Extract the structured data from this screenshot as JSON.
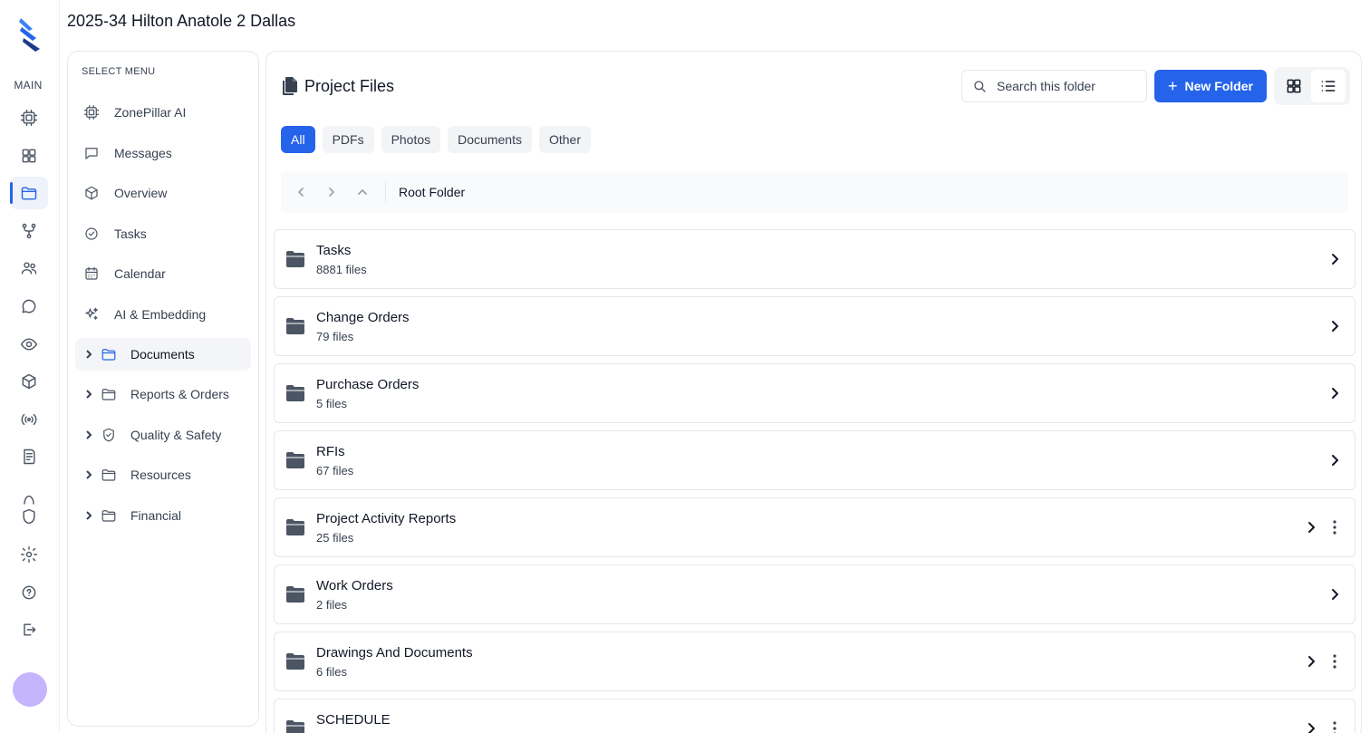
{
  "app": {
    "project_title": "2025-34 Hilton Anatole 2 Dallas"
  },
  "rail": {
    "section_label": "MAIN",
    "items": [
      {
        "icon": "chip-icon"
      },
      {
        "icon": "dashboard-icon"
      },
      {
        "icon": "folder-icon",
        "active": true
      },
      {
        "icon": "git-branch-icon"
      },
      {
        "icon": "users-icon"
      },
      {
        "icon": "chat-icon"
      },
      {
        "icon": "eye-icon"
      },
      {
        "icon": "cube-icon"
      },
      {
        "icon": "broadcast-icon"
      },
      {
        "icon": "receipt-icon"
      },
      {
        "icon": "shield-icon"
      },
      {
        "icon": "gear-icon"
      },
      {
        "icon": "help-icon"
      },
      {
        "icon": "logout-icon"
      }
    ]
  },
  "menu": {
    "heading": "SELECT MENU",
    "items": [
      {
        "label": "ZonePillar AI",
        "icon": "chip-icon"
      },
      {
        "label": "Messages",
        "icon": "message-icon"
      },
      {
        "label": "Overview",
        "icon": "cube-icon"
      },
      {
        "label": "Tasks",
        "icon": "check-circle-icon"
      },
      {
        "label": "Calendar",
        "icon": "calendar-icon"
      },
      {
        "label": "AI & Embedding",
        "icon": "sparkles-icon"
      }
    ],
    "tree": [
      {
        "label": "Documents",
        "icon": "folder-icon",
        "active": true
      },
      {
        "label": "Reports & Orders",
        "icon": "folder-icon"
      },
      {
        "label": "Quality & Safety",
        "icon": "shield-check-icon"
      },
      {
        "label": "Resources",
        "icon": "folder-icon"
      },
      {
        "label": "Financial",
        "icon": "folder-icon"
      }
    ]
  },
  "main": {
    "title": "Project Files",
    "search_placeholder": "Search this folder",
    "new_folder_label": "New Folder",
    "view_modes": [
      "grid-view-icon",
      "list-view-icon"
    ],
    "active_view": "list",
    "filters": [
      {
        "label": "All",
        "active": true
      },
      {
        "label": "PDFs"
      },
      {
        "label": "Photos"
      },
      {
        "label": "Documents"
      },
      {
        "label": "Other"
      }
    ],
    "breadcrumb": "Root Folder",
    "colors": {
      "accent": "#2563eb",
      "avatar": "#c4b5fd"
    },
    "folders": [
      {
        "name": "Tasks",
        "count": "8881 files",
        "menu": false
      },
      {
        "name": "Change Orders",
        "count": "79 files",
        "menu": false
      },
      {
        "name": "Purchase Orders",
        "count": "5 files",
        "menu": false
      },
      {
        "name": "RFIs",
        "count": "67 files",
        "menu": false
      },
      {
        "name": "Project Activity Reports",
        "count": "25 files",
        "menu": true
      },
      {
        "name": "Work Orders",
        "count": "2 files",
        "menu": false
      },
      {
        "name": "Drawings And Documents",
        "count": "6 files",
        "menu": true
      },
      {
        "name": "SCHEDULE",
        "count": "",
        "menu": true
      }
    ]
  }
}
